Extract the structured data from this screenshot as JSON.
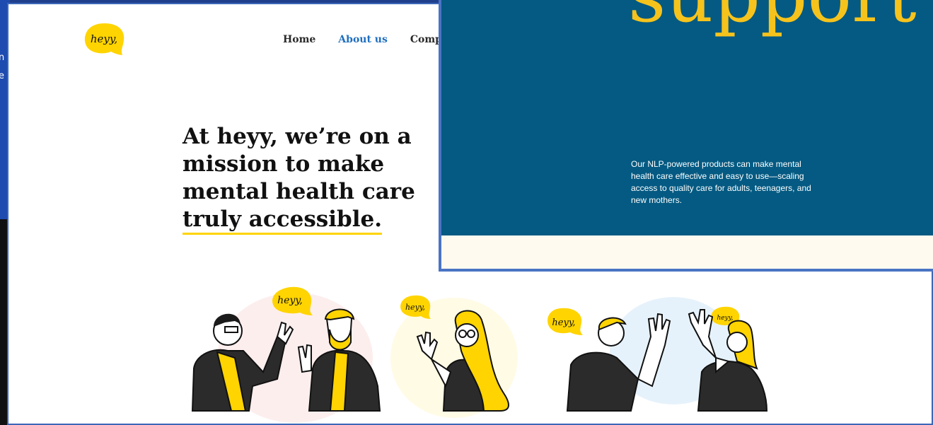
{
  "background": {
    "fragments": [
      "n",
      "e"
    ]
  },
  "logo": {
    "text": "heyy,"
  },
  "nav": {
    "items": [
      {
        "label": "Home",
        "active": false
      },
      {
        "label": "About us",
        "active": true
      },
      {
        "label": "Company",
        "active": false
      }
    ]
  },
  "hero": {
    "headline_pre": "At heyy, we’re on a mission to make mental health care",
    "headline_highlight": "truly accessible."
  },
  "illustration": {
    "bubble_text": "heyy,"
  },
  "overlay": {
    "big_text": "support fo",
    "description": "Our NLP-powered products can make mental health care effective and easy to use—scaling access to quality care for adults, teenagers, and new mothers."
  },
  "colors": {
    "brand_yellow": "#ffd400",
    "nav_active": "#1f6fbf",
    "hero_blue": "#045a82",
    "big_text_yellow": "#f6c31c",
    "window_border": "#3c66b8"
  }
}
